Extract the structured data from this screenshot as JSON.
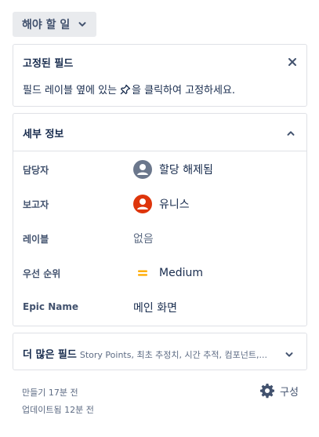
{
  "status": {
    "label": "해야 할 일"
  },
  "pinned": {
    "title": "고정된 필드",
    "desc_before": "필드 레이블 옆에 있는",
    "desc_after": "을 클릭하여 고정하세요."
  },
  "details": {
    "title": "세부 정보",
    "fields": [
      {
        "label": "담당자",
        "value": "할당 해제됨"
      },
      {
        "label": "보고자",
        "value": "유니스"
      },
      {
        "label": "레이블",
        "value": "없음"
      },
      {
        "label": "우선 순위",
        "value": "Medium"
      },
      {
        "label": "Epic Name",
        "value": "메인 화면"
      }
    ]
  },
  "more": {
    "title": "더 많은 필드",
    "subtitle": "Story Points, 최초 추정치, 시간 추적, 컴포넌트,..."
  },
  "footer": {
    "created": "만들기 17분 전",
    "updated": "업데이트됨 12분 전",
    "config_label": "구성"
  },
  "colors": {
    "reporter_avatar": "#de350b",
    "priority_medium": "#ffab00",
    "unassigned_avatar": "#6b778c"
  }
}
